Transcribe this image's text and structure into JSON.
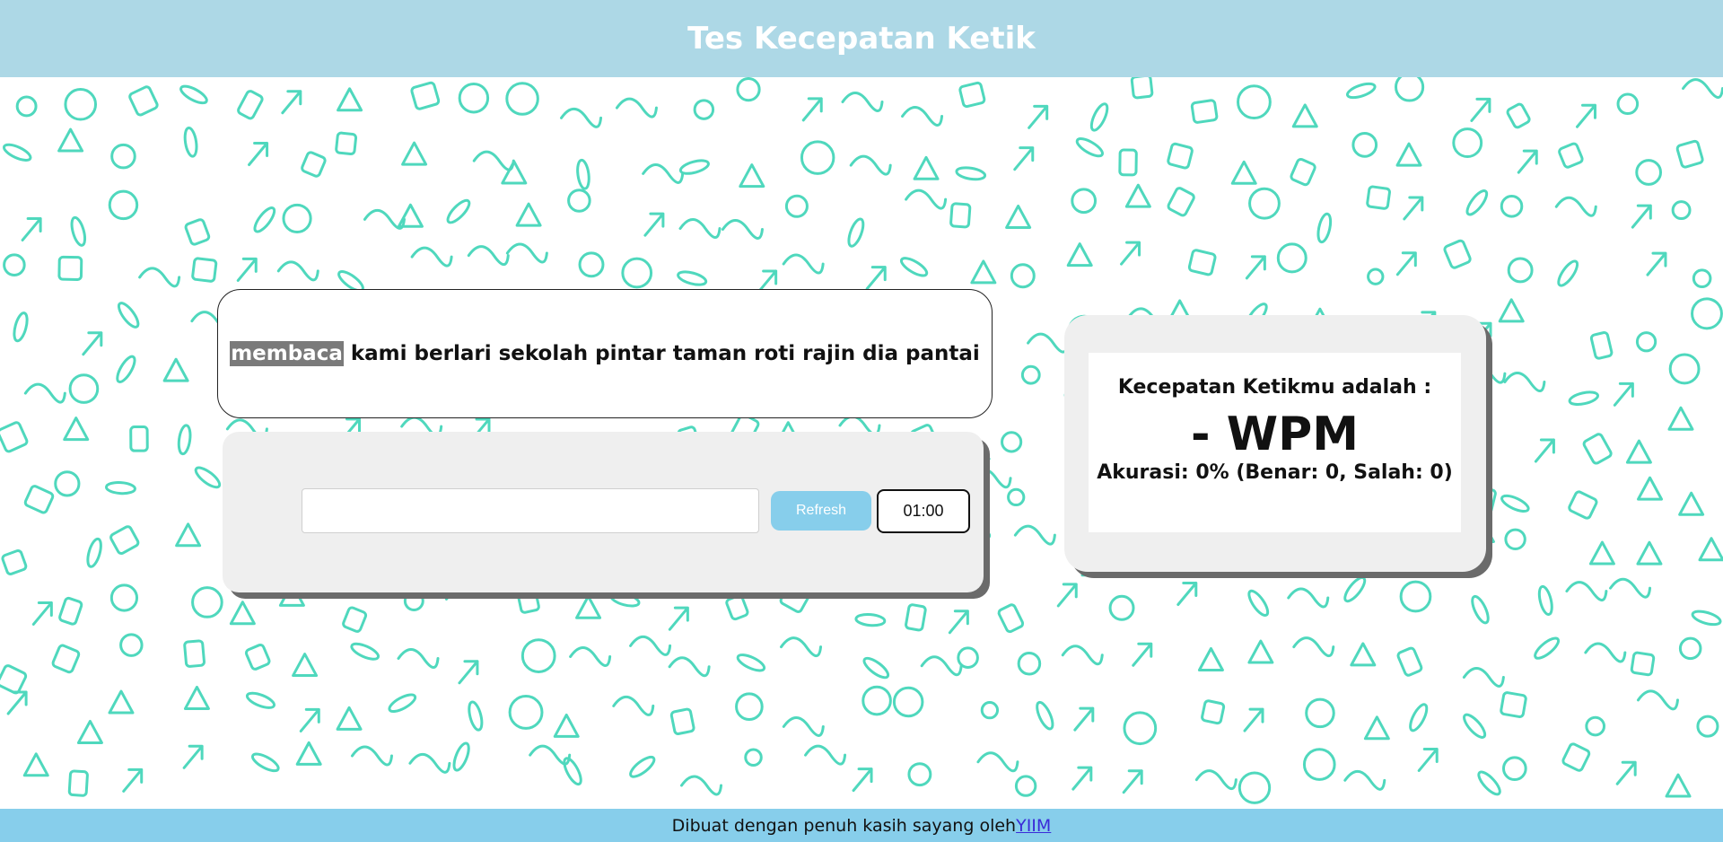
{
  "header": {
    "title": "Tes Kecepatan Ketik"
  },
  "words": {
    "current": "membaca",
    "rest": " kami berlari sekolah pintar taman roti rajin dia pantai"
  },
  "typing": {
    "value": "",
    "placeholder": ""
  },
  "controls": {
    "refresh_label": "Refresh",
    "timer": "01:00"
  },
  "result": {
    "title": "Kecepatan Ketikmu adalah :",
    "wpm": "- WPM",
    "accuracy": "Akurasi: 0% (Benar: 0, Salah: 0)"
  },
  "footer": {
    "text": "Dibuat dengan penuh kasih sayang oleh",
    "link": "YIIM"
  },
  "colors": {
    "header_bg": "#add8e6",
    "footer_bg": "#87ceeb",
    "refresh_bg": "#87ceeb",
    "pattern": "#4fd8bd",
    "highlight": "#7a7a7a"
  },
  "icons": {
    "background_pattern": "doodle-pattern"
  }
}
